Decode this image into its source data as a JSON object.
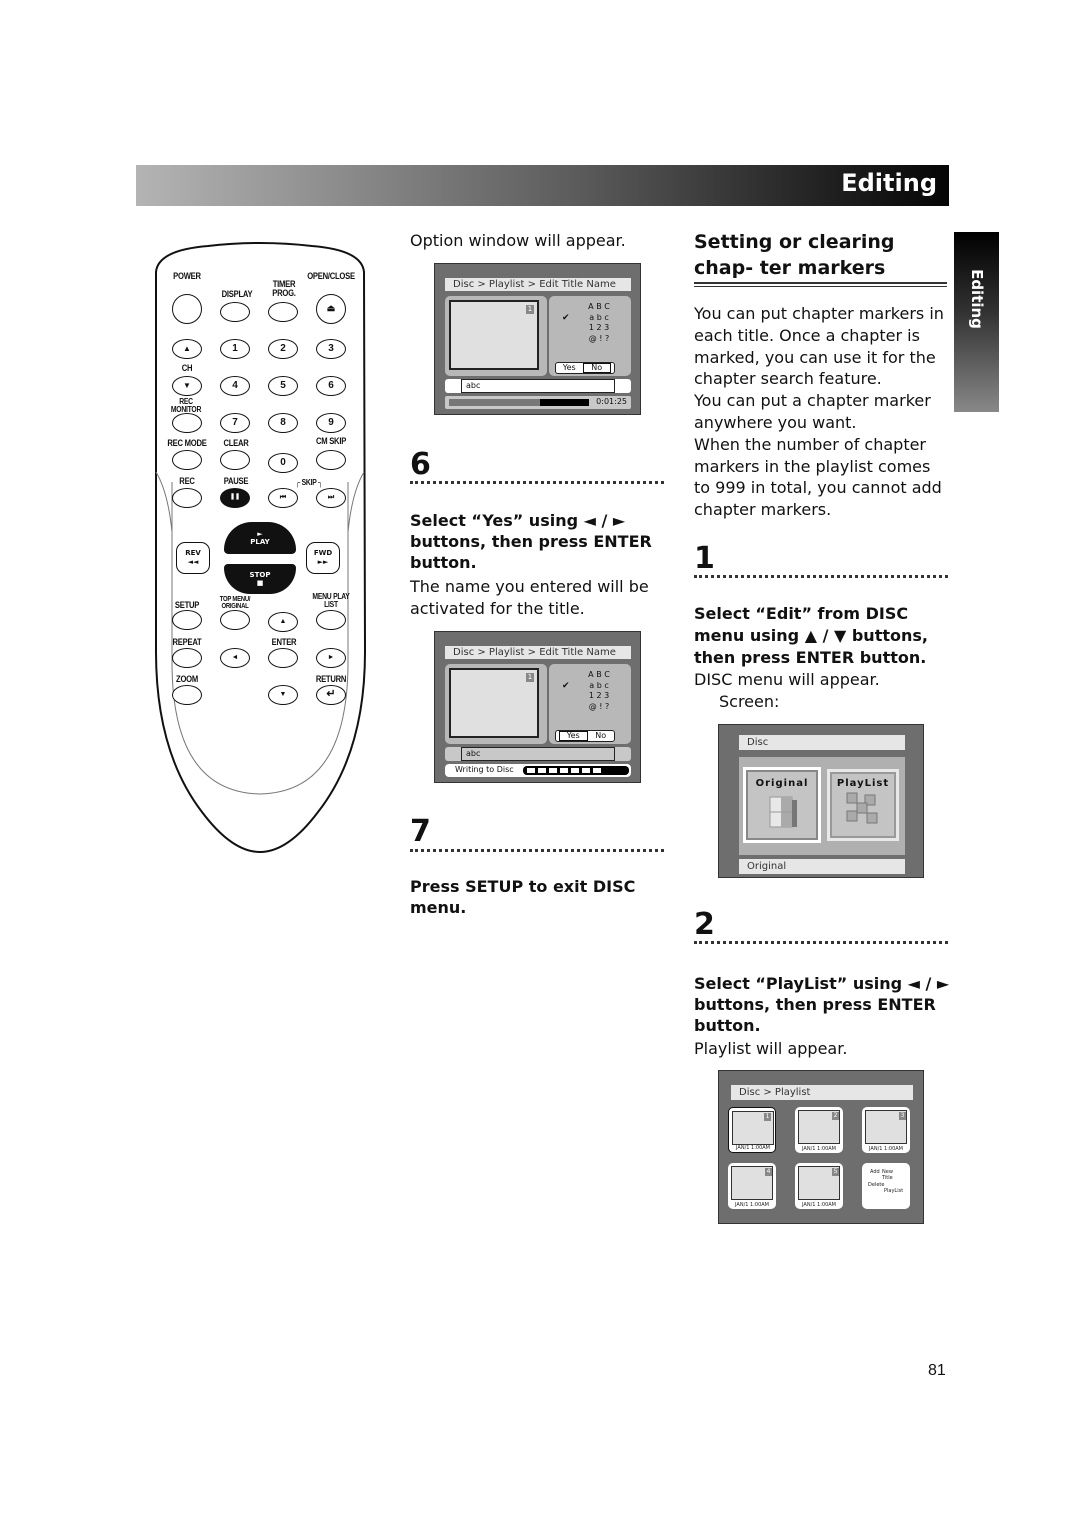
{
  "header": {
    "section_title": "Editing"
  },
  "side_tab": {
    "label": "Editing"
  },
  "page_number": "81",
  "remote": {
    "labels": {
      "power": "POWER",
      "display": "DISPLAY",
      "timer_prog": "TIMER PROG.",
      "open_close": "OPEN/CLOSE",
      "ch": "CH",
      "rec_monitor": "REC MONITOR",
      "rec_mode": "REC MODE",
      "clear": "CLEAR",
      "cm_skip": "CM SKIP",
      "rec": "REC",
      "pause": "PAUSE",
      "skip": "SKIP",
      "rev": "REV",
      "fwd": "FWD",
      "play": "PLAY",
      "stop": "STOP",
      "setup": "SETUP",
      "top_menu": "TOP MENU/ ORIGINAL",
      "menu": "MENU PLAY LIST",
      "repeat": "REPEAT",
      "enter": "ENTER",
      "zoom": "ZOOM",
      "return": "RETURN"
    },
    "digits": [
      "1",
      "2",
      "3",
      "4",
      "5",
      "6",
      "7",
      "8",
      "9",
      "0"
    ],
    "glyphs": {
      "eject": "⏏",
      "up": "▲",
      "down": "▼",
      "left": "◄",
      "right": "►",
      "pause": "❚❚",
      "prev": "⏮",
      "next": "⏭",
      "rew": "◄◄",
      "ff": "►►",
      "play": "►",
      "stop": "■",
      "return": "↵"
    }
  },
  "middle": {
    "intro": "Option window will appear.",
    "screen1": {
      "breadcrumb": "Disc > Playlist > Edit Title Name",
      "thumb_index": "1",
      "char_sets": [
        "A B C",
        "a b c",
        "1 2 3",
        "@ ! ?"
      ],
      "checkmark": "✔",
      "yes": "Yes",
      "no": "No",
      "selected": "No",
      "name_field": "abc",
      "progress": 0.65,
      "time": "0:01:25"
    },
    "step6": {
      "number": "6",
      "instruction": "Select “Yes” using ◄ / ► buttons, then press ENTER button.",
      "result": "The name you entered will be activated for the title."
    },
    "screen2": {
      "breadcrumb": "Disc > Playlist > Edit Title Name",
      "thumb_index": "1",
      "char_sets": [
        "A B C",
        "a b c",
        "1 2 3",
        "@ ! ?"
      ],
      "checkmark": "✔",
      "yes": "Yes",
      "no": "No",
      "selected": "Yes",
      "name_field": "abc",
      "status": "Writing to Disc",
      "progress_blocks": 7
    },
    "step7": {
      "number": "7",
      "instruction": "Press SETUP to exit DISC menu."
    }
  },
  "right": {
    "title": "Setting or clearing chap- ter markers",
    "paragraphs": [
      "You can put chapter markers in each title. Once a chapter is marked, you can use it for the chapter search feature.",
      "You can put a chapter marker anywhere you want.",
      "When the number of chapter markers in the playlist comes to 999 in total, you cannot add chapter markers."
    ],
    "step1": {
      "number": "1",
      "instruction": "Select “Edit” from DISC menu using ▲ / ▼ buttons, then press ENTER button.",
      "result": "DISC menu will appear.",
      "screen_label": "Screen:"
    },
    "disc_screen": {
      "title": "Disc",
      "options": [
        "Original",
        "PlayList"
      ],
      "selected": "Original",
      "footer": "Original"
    },
    "step2": {
      "number": "2",
      "instruction": "Select “PlayList” using ◄ / ► buttons, then press ENTER button.",
      "result": "Playlist will appear."
    },
    "playlist_screen": {
      "title": "Disc > Playlist",
      "items": [
        {
          "index": "1",
          "date": "JAN/1   1:00AM"
        },
        {
          "index": "2",
          "date": "JAN/1   1:00AM"
        },
        {
          "index": "3",
          "date": "JAN/1   1:00AM"
        },
        {
          "index": "4",
          "date": "JAN/1   1:00AM"
        },
        {
          "index": "5",
          "date": "JAN/1   1:00AM"
        }
      ],
      "actions": {
        "add": "Add",
        "new_title": "New Title",
        "delete": "Delete",
        "playlist": "PlayList"
      }
    }
  }
}
